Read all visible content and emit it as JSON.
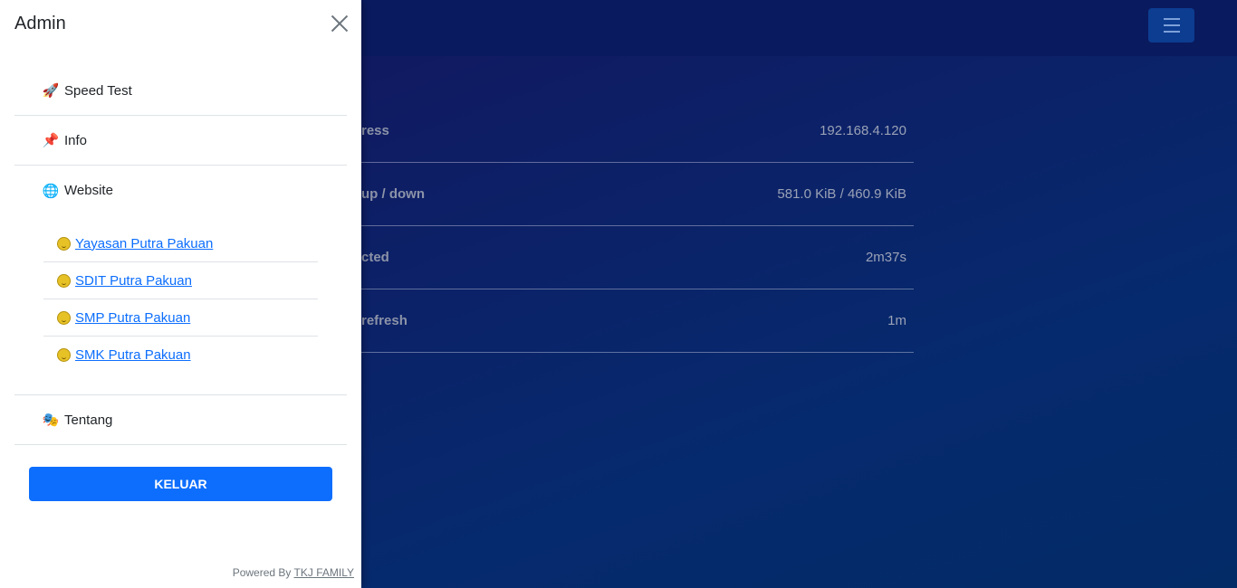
{
  "drawer": {
    "title": "Admin",
    "menu": [
      {
        "icon": "rocket-icon",
        "glyph": "🚀",
        "label": "Speed Test"
      },
      {
        "icon": "pushpin-icon",
        "glyph": "📌",
        "label": "Info"
      },
      {
        "icon": "globe-icon",
        "glyph": "🌐",
        "label": "Website"
      }
    ],
    "website_links": [
      {
        "icon": "smiley-icon",
        "label": "Yayasan Putra Pakuan"
      },
      {
        "icon": "smiley-icon",
        "label": "SDIT Putra Pakuan"
      },
      {
        "icon": "smiley-icon",
        "label": "SMP Putra Pakuan"
      },
      {
        "icon": "smiley-icon",
        "label": "SMK Putra Pakuan"
      }
    ],
    "tentang": {
      "icon": "theater-masks-icon",
      "glyph": "🎭",
      "label": "Tentang"
    },
    "logout_label": "KELUAR",
    "footer": {
      "prefix": "Powered By",
      "link": "TKJ FAMILY"
    }
  },
  "stats": [
    {
      "label": "ress",
      "value": "192.168.4.120"
    },
    {
      "label": "up / down",
      "value": "581.0 KiB / 460.9 KiB"
    },
    {
      "label": "cted",
      "value": "2m37s"
    },
    {
      "label": "refresh",
      "value": "1m"
    }
  ],
  "colors": {
    "accent": "#0d6efd",
    "background": "#0b1d5e"
  }
}
